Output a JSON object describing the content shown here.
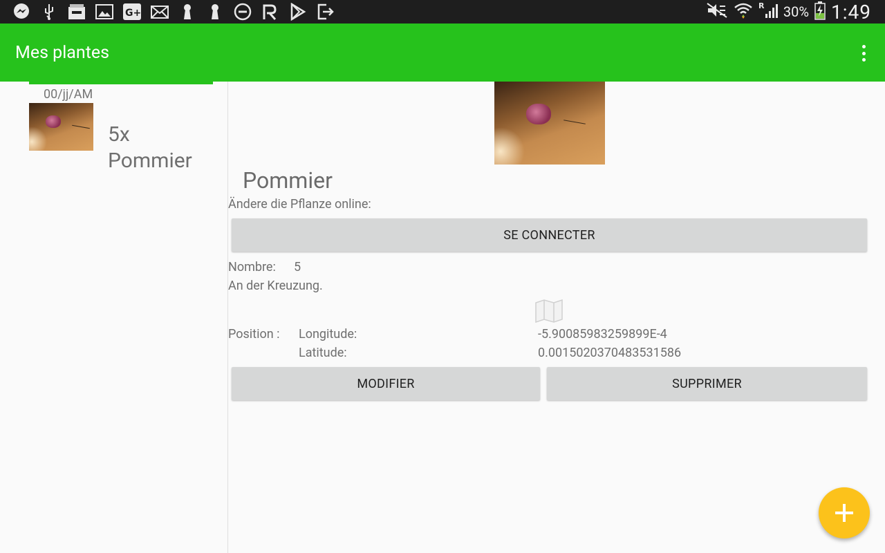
{
  "status_bar": {
    "icons_left": [
      "messenger-icon",
      "usb-icon",
      "store-icon",
      "gallery-icon",
      "google-plus-icon",
      "mail-icon",
      "keyhole-icon",
      "keyhole-icon",
      "do-not-disturb-icon",
      "ra-icon",
      "play-store-icon",
      "exit-icon"
    ],
    "battery": "30%",
    "time": "1:49"
  },
  "app_bar": {
    "title": "Mes plantes"
  },
  "left_list": {
    "date": "00/jj/AM",
    "item": {
      "count": "5x",
      "name": "Pommier"
    }
  },
  "detail": {
    "name": "Pommier",
    "online_label": "Ändere die Pflanze online:",
    "connect_button": "SE CONNECTER",
    "number_label": "Nombre:",
    "number_value": "5",
    "note": "An der Kreuzung.",
    "position_label": "Position :",
    "longitude_label": "Longitude:",
    "longitude_value": "-5.90085983259899E-4",
    "latitude_label": "Latitude:",
    "latitude_value": "0.0015020370483531586",
    "modify_button": "MODIFIER",
    "delete_button": "SUPPRIMER"
  },
  "colors": {
    "app_bar": "#26c21c",
    "fab": "#fcc21b",
    "button": "#d6d7d7"
  }
}
